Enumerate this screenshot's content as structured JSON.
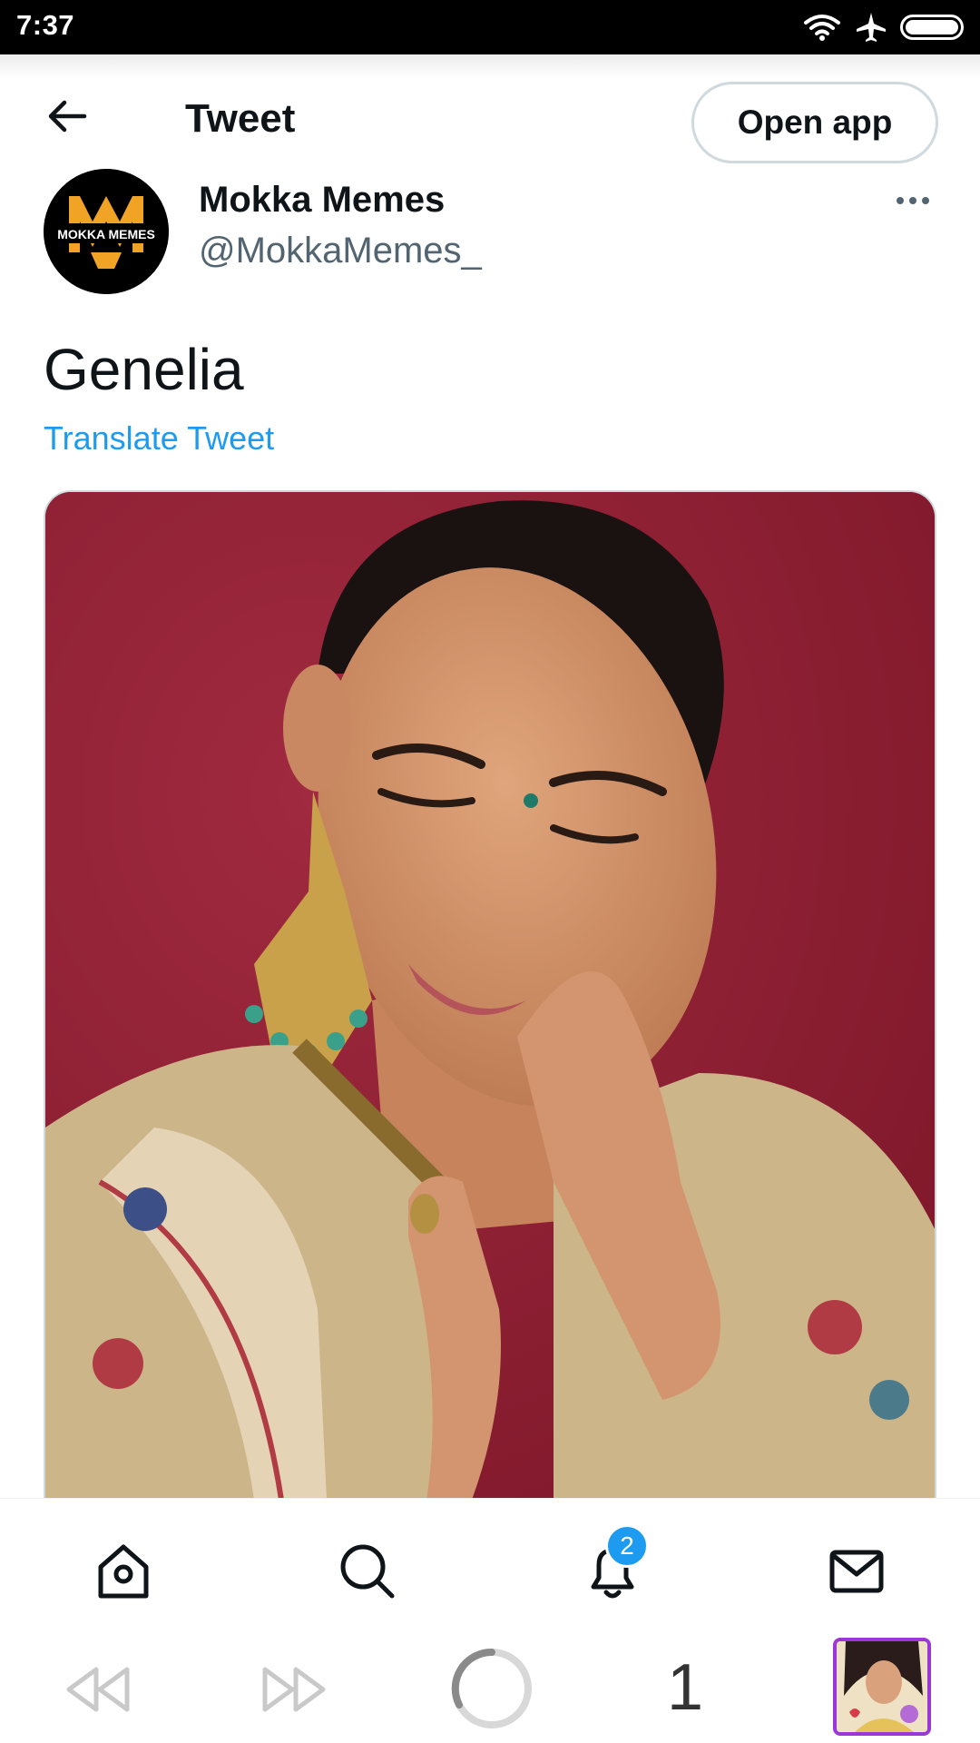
{
  "status_bar": {
    "time": "7:37",
    "icons": [
      "wifi-icon",
      "airplane-icon",
      "battery-icon"
    ]
  },
  "header": {
    "title": "Tweet",
    "open_app_label": "Open app"
  },
  "tweet": {
    "author_name": "Mokka Memes",
    "author_handle": "@MokkaMemes_",
    "avatar_text": "MOKKA MEMES",
    "text": "Genelia",
    "translate_label": "Translate Tweet"
  },
  "tabs": {
    "items": [
      "home-icon",
      "search-icon",
      "notifications-icon",
      "messages-icon"
    ],
    "notification_count": "2"
  },
  "browser": {
    "tab_count": "1"
  },
  "colors": {
    "accent": "#1d9bf0",
    "text": "#0f1419",
    "muted": "#536471",
    "thumb_border": "#9b37d8"
  }
}
